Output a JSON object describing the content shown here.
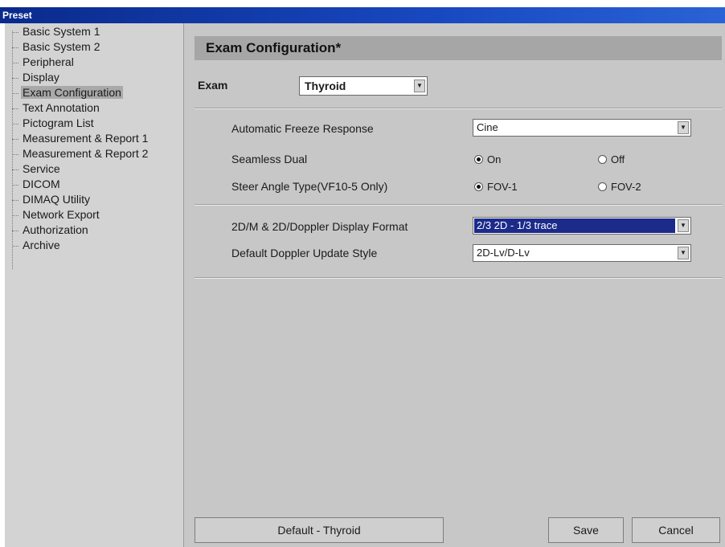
{
  "window": {
    "title": "Preset"
  },
  "sidebar": {
    "items": [
      {
        "label": "Basic System 1"
      },
      {
        "label": "Basic System 2"
      },
      {
        "label": "Peripheral"
      },
      {
        "label": "Display"
      },
      {
        "label": "Exam Configuration",
        "selected": true
      },
      {
        "label": "Text Annotation"
      },
      {
        "label": "Pictogram List"
      },
      {
        "label": "Measurement & Report 1"
      },
      {
        "label": "Measurement & Report 2"
      },
      {
        "label": "Service"
      },
      {
        "label": "DICOM"
      },
      {
        "label": "DIMAQ Utility"
      },
      {
        "label": "Network Export"
      },
      {
        "label": "Authorization"
      },
      {
        "label": "Archive"
      }
    ]
  },
  "main": {
    "header": "Exam Configuration*",
    "exam_label": "Exam",
    "exam_value": "Thyroid",
    "auto_freeze": {
      "label": "Automatic Freeze Response",
      "value": "Cine"
    },
    "seamless_dual": {
      "label": "Seamless Dual",
      "option_on": "On",
      "option_off": "Off",
      "selected": "On"
    },
    "steer_angle": {
      "label": "Steer Angle Type(VF10-5 Only)",
      "option_1": "FOV-1",
      "option_2": "FOV-2",
      "selected": "FOV-1"
    },
    "display_format": {
      "label": "2D/M & 2D/Doppler Display Format",
      "value": "2/3 2D - 1/3 trace"
    },
    "doppler_update": {
      "label": "Default Doppler Update Style",
      "value": "2D-Lv/D-Lv"
    }
  },
  "footer": {
    "default_label": "Default - Thyroid",
    "save_label": "Save",
    "cancel_label": "Cancel"
  },
  "icons": {
    "dropdown": "chevron-down-icon",
    "radio": "radio-button-icon"
  }
}
